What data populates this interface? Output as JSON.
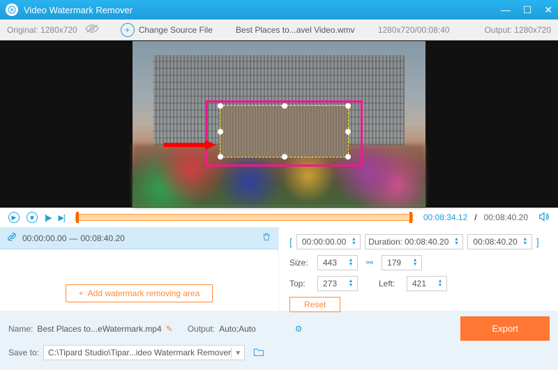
{
  "titlebar": {
    "title": "Video Watermark Remover"
  },
  "infobar": {
    "original": "Original: 1280x720",
    "change_source": "Change Source File",
    "filename": "Best Places to...avel Video.wmv",
    "resolution_time": "1280x720/00:08:40",
    "output": "Output: 1280x720"
  },
  "player": {
    "current": "00:08:34.12",
    "sep": "/",
    "total": "00:08:40.20"
  },
  "segment": {
    "start": "00:00:00.00",
    "dash": "—",
    "end": "00:08:40.20"
  },
  "add_area": "Add watermark removing area",
  "time": {
    "start": "00:00:00.00",
    "duration_label": "Duration:",
    "duration": "00:08:40.20",
    "end": "00:08:40.20"
  },
  "pos": {
    "size_label": "Size:",
    "w": "443",
    "h": "179",
    "top_label": "Top:",
    "top": "273",
    "left_label": "Left:",
    "left": "421"
  },
  "reset": "Reset",
  "bottom": {
    "name_label": "Name:",
    "name": "Best Places to...eWatermark.mp4",
    "output_label": "Output:",
    "output": "Auto;Auto",
    "save_label": "Save to:",
    "save_path": "C:\\Tipard Studio\\Tipar...ideo Watermark Remover",
    "export": "Export"
  }
}
